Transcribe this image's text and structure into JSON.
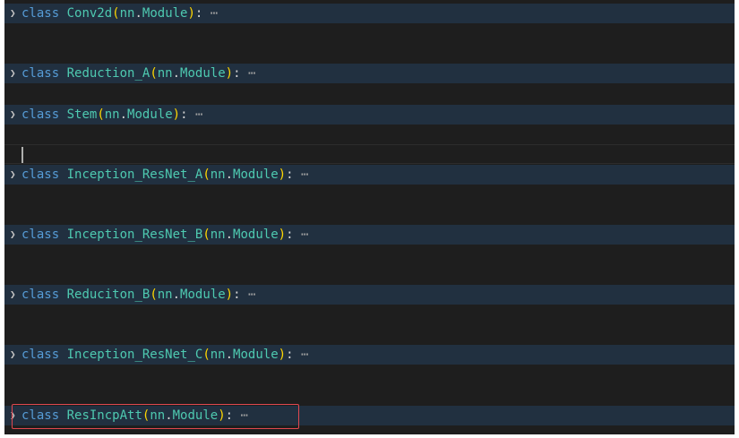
{
  "editor": {
    "lines": [
      {
        "keyword": "class",
        "name": "Conv2d",
        "open": "(",
        "base_ns": "nn",
        "dot": ".",
        "base_cls": "Module",
        "close": ")",
        "colon": ":",
        "ellipsis": "⋯"
      },
      {
        "keyword": "class",
        "name": "Reduction_A",
        "open": "(",
        "base_ns": "nn",
        "dot": ".",
        "base_cls": "Module",
        "close": ")",
        "colon": ":",
        "ellipsis": "⋯"
      },
      {
        "keyword": "class",
        "name": "Stem",
        "open": "(",
        "base_ns": "nn",
        "dot": ".",
        "base_cls": "Module",
        "close": ")",
        "colon": ":",
        "ellipsis": "⋯"
      },
      {
        "keyword": "class",
        "name": "Inception_ResNet_A",
        "open": "(",
        "base_ns": "nn",
        "dot": ".",
        "base_cls": "Module",
        "close": ")",
        "colon": ":",
        "ellipsis": "⋯"
      },
      {
        "keyword": "class",
        "name": "Inception_ResNet_B",
        "open": "(",
        "base_ns": "nn",
        "dot": ".",
        "base_cls": "Module",
        "close": ")",
        "colon": ":",
        "ellipsis": "⋯"
      },
      {
        "keyword": "class",
        "name": "Reduciton_B",
        "open": "(",
        "base_ns": "nn",
        "dot": ".",
        "base_cls": "Module",
        "close": ")",
        "colon": ":",
        "ellipsis": "⋯"
      },
      {
        "keyword": "class",
        "name": "Inception_ResNet_C",
        "open": "(",
        "base_ns": "nn",
        "dot": ".",
        "base_cls": "Module",
        "close": ")",
        "colon": ":",
        "ellipsis": "⋯"
      },
      {
        "keyword": "class",
        "name": "ResIncpAtt",
        "open": "(",
        "base_ns": "nn",
        "dot": ".",
        "base_cls": "Module",
        "close": ")",
        "colon": ":",
        "ellipsis": "⋯"
      }
    ],
    "fold_icon": "chevron-right-icon",
    "colors": {
      "background": "#1e1e1e",
      "keyword": "#569cd6",
      "class_name": "#4ec9b0",
      "bracket": "#ffd700",
      "highlight_box": "#e0484f"
    }
  }
}
